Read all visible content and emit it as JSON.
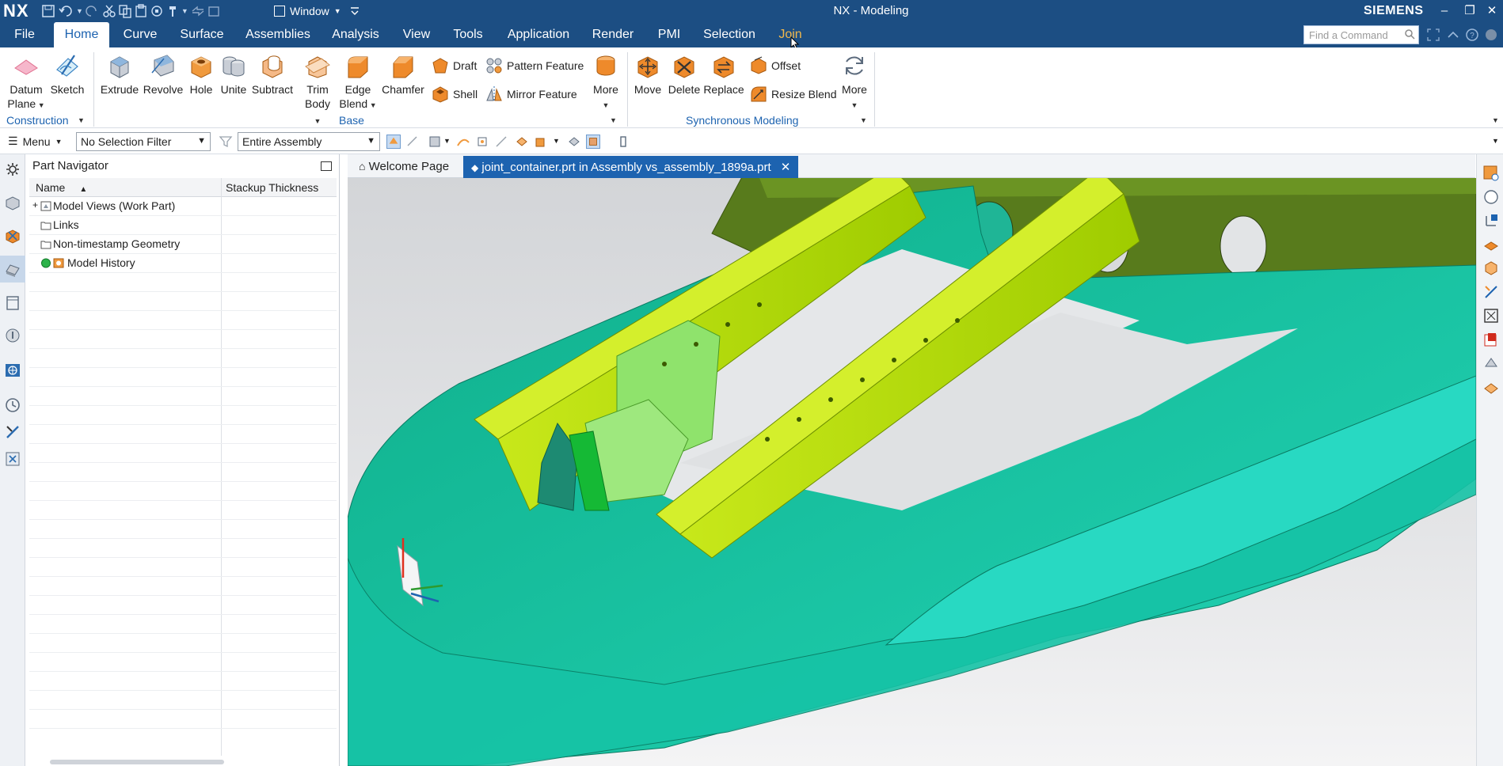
{
  "app": {
    "logo": "NX",
    "title": "NX - Modeling",
    "brand": "SIEMENS",
    "window_menu": "Window"
  },
  "menu_tabs": [
    {
      "label": "File"
    },
    {
      "label": "Home"
    },
    {
      "label": "Curve"
    },
    {
      "label": "Surface"
    },
    {
      "label": "Assemblies"
    },
    {
      "label": "Analysis"
    },
    {
      "label": "View"
    },
    {
      "label": "Tools"
    },
    {
      "label": "Application"
    },
    {
      "label": "Render"
    },
    {
      "label": "PMI"
    },
    {
      "label": "Selection"
    },
    {
      "label": "Join"
    }
  ],
  "active_tab": "Home",
  "command_finder": {
    "placeholder": "Find a Command"
  },
  "ribbon": {
    "construction": {
      "label": "Construction",
      "datum_plane": "Datum\nPlane",
      "sketch": "Sketch"
    },
    "base": {
      "label": "Base",
      "extrude": "Extrude",
      "revolve": "Revolve",
      "hole": "Hole",
      "unite": "Unite",
      "subtract": "Subtract",
      "trim_body": "Trim\nBody",
      "edge_blend": "Edge\nBlend",
      "chamfer": "Chamfer",
      "draft": "Draft",
      "shell": "Shell",
      "pattern_feature": "Pattern Feature",
      "mirror_feature": "Mirror Feature",
      "more": "More"
    },
    "synchronous": {
      "label": "Synchronous Modeling",
      "move": "Move",
      "delete": "Delete",
      "replace": "Replace",
      "offset": "Offset",
      "resize_blend": "Resize Blend",
      "more": "More"
    }
  },
  "toolbar": {
    "menu_label": "Menu",
    "selection_filter": "No Selection Filter",
    "scope": "Entire Assembly"
  },
  "part_navigator": {
    "title": "Part Navigator",
    "columns": [
      "Name",
      "Stackup Thickness"
    ],
    "rows": [
      {
        "label": "Model Views (Work Part)"
      },
      {
        "label": "Links"
      },
      {
        "label": "Non-timestamp Geometry"
      },
      {
        "label": "Model History"
      }
    ]
  },
  "doc_tabs": [
    {
      "label": "Welcome Page"
    },
    {
      "label": "joint_container.prt in Assembly vs_assembly_1899a.prt"
    }
  ],
  "colors": {
    "title_bar": "#1c4e83",
    "accent_blue": "#1d63b0",
    "hover_orange": "#f2b84b",
    "model_teal": "#17b49a",
    "model_lime": "#a8cc12",
    "model_olive": "#5f7d1c"
  }
}
